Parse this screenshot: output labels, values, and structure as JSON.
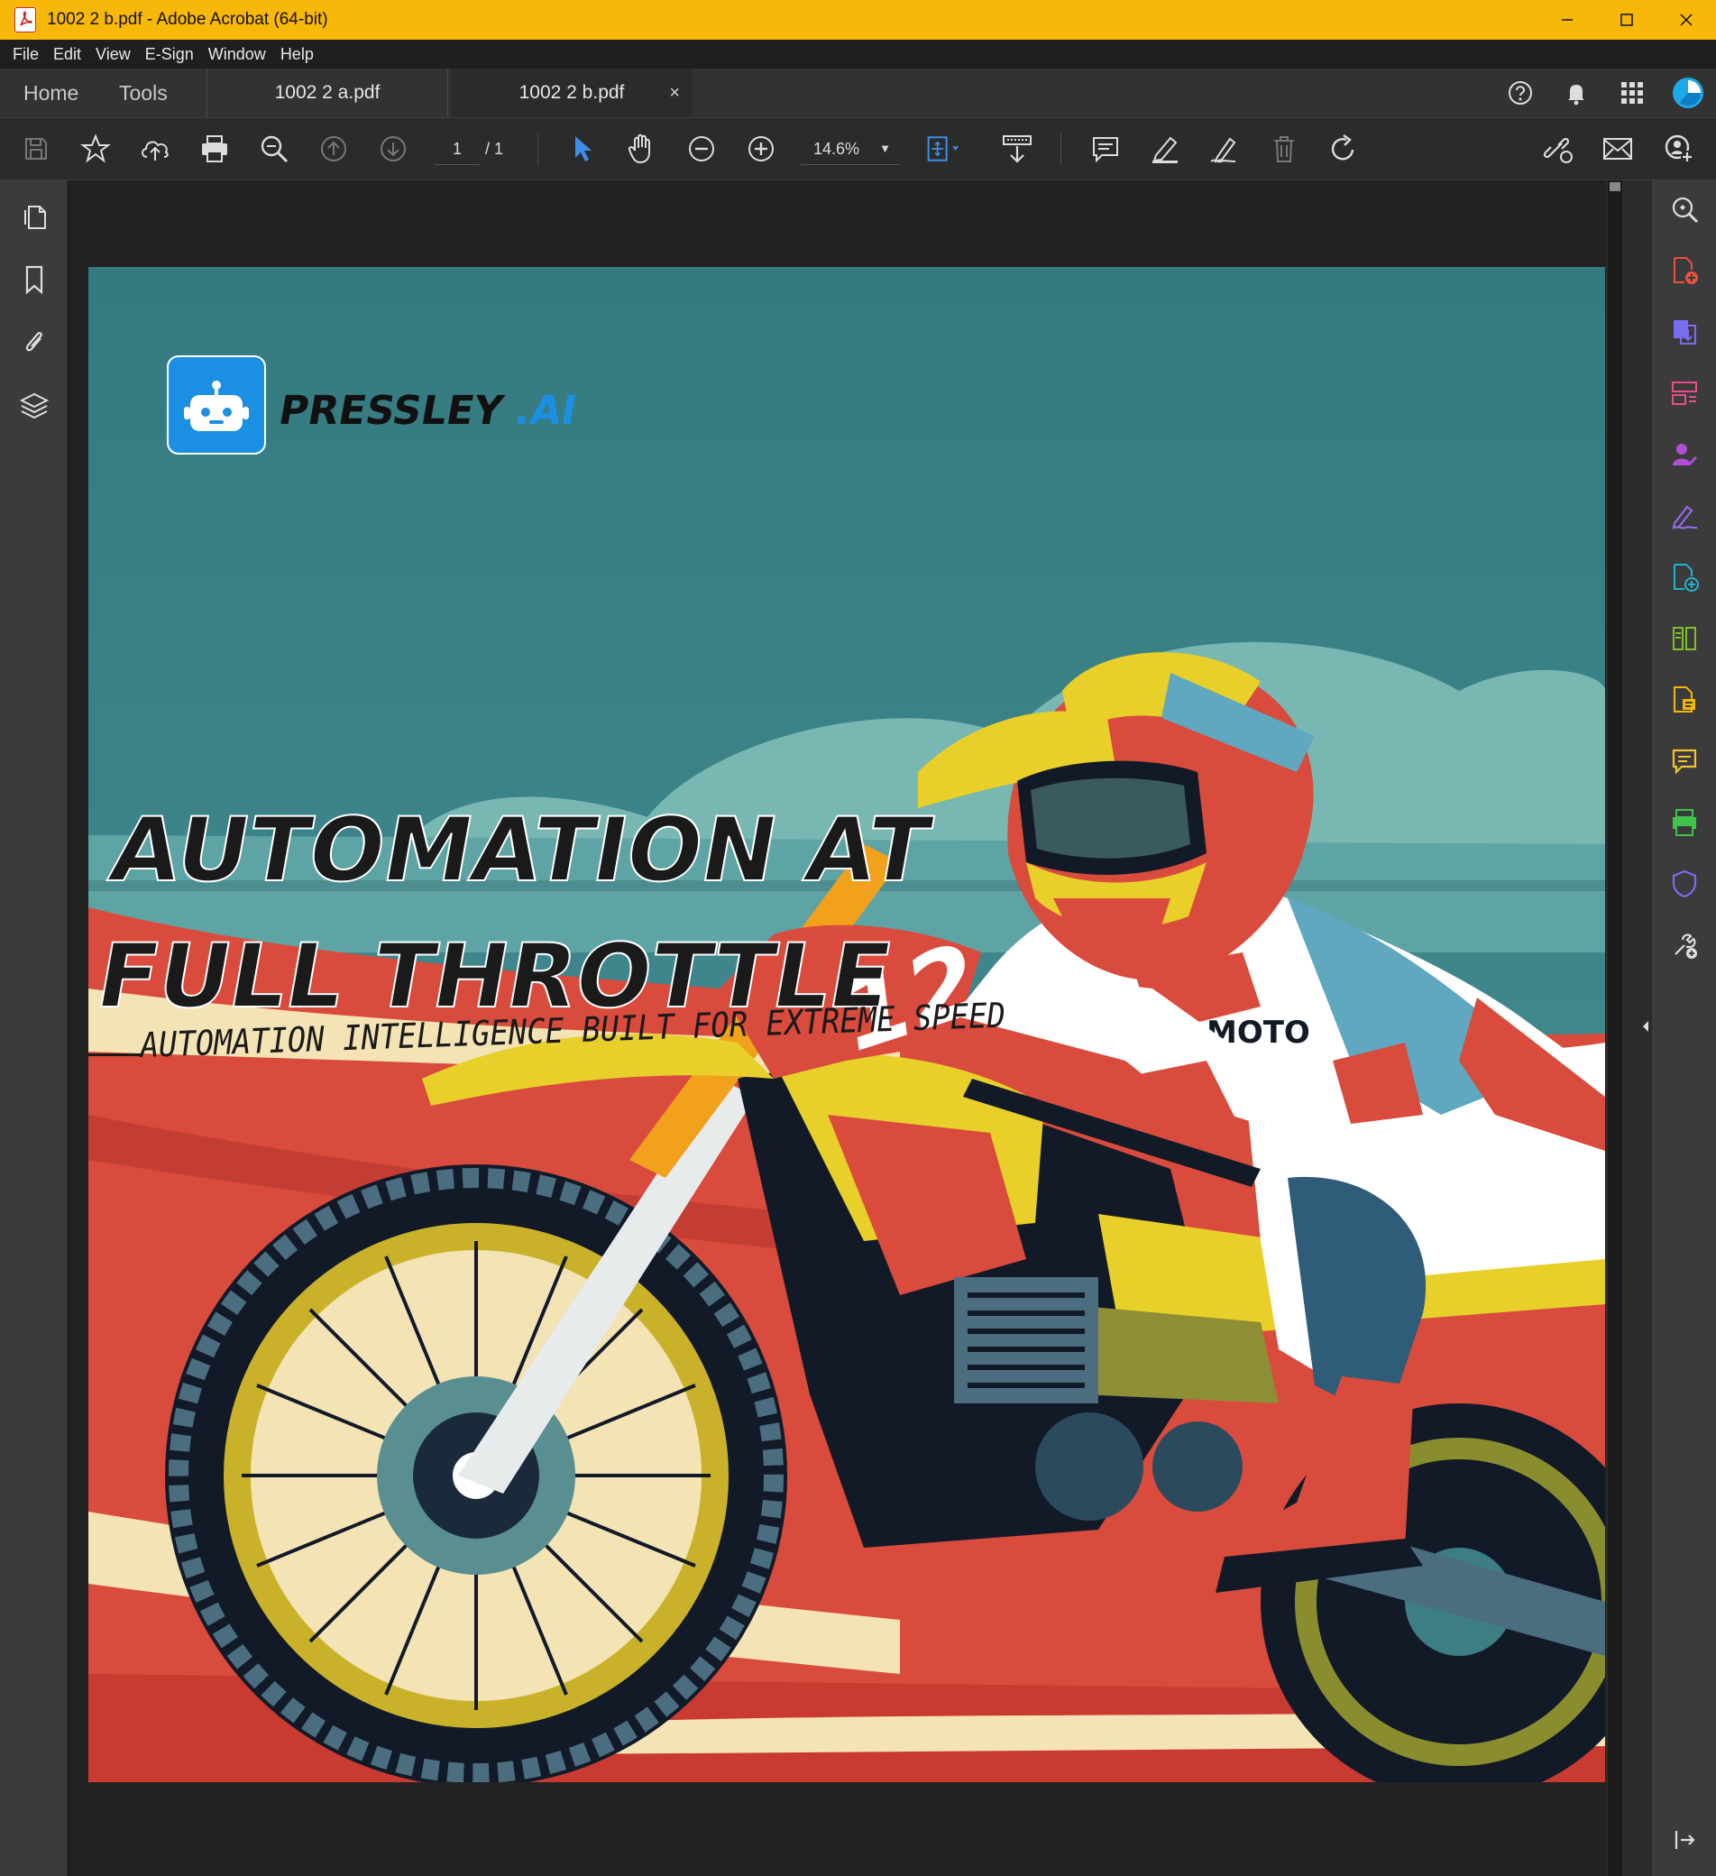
{
  "window": {
    "title": "1002 2 b.pdf - Adobe Acrobat (64-bit)",
    "accent_color": "#f8b80a"
  },
  "menu": [
    "File",
    "Edit",
    "View",
    "E-Sign",
    "Window",
    "Help"
  ],
  "tabs": {
    "home": "Home",
    "tools": "Tools",
    "documents": [
      {
        "label": "1002 2 a.pdf",
        "active": false
      },
      {
        "label": "1002 2 b.pdf",
        "active": true
      }
    ],
    "close_glyph": "×"
  },
  "toolbar": {
    "page_current": "1",
    "page_total": "/ 1",
    "zoom": "14.6%"
  },
  "icons": {
    "tab_right": [
      "help-icon",
      "bell-icon",
      "apps-grid-icon",
      "account-avatar-icon"
    ],
    "toolbar": [
      "save-icon",
      "star-icon",
      "cloud-upload-icon",
      "print-icon",
      "zoom-search-icon",
      "page-up-icon",
      "page-down-icon",
      "select-cursor-icon",
      "hand-icon",
      "zoom-out-icon",
      "zoom-in-icon",
      "fit-page-icon",
      "scroll-mode-icon",
      "comment-icon",
      "highlight-icon",
      "draw-icon",
      "delete-icon",
      "rotate-icon",
      "share-link-icon",
      "email-icon",
      "share-user-icon"
    ],
    "left_rail": [
      "page-thumbnails-icon",
      "bookmark-icon",
      "attachment-icon",
      "layers-icon"
    ],
    "right_rail": [
      "search-zoom-icon",
      "create-pdf-icon",
      "export-pdf-icon",
      "organize-pages-icon",
      "request-signature-icon",
      "fill-sign-icon",
      "combine-files-icon",
      "compress-pdf-icon",
      "edit-pdf-icon",
      "comment-tool-icon",
      "scan-ocr-icon",
      "protect-icon",
      "more-tools-icon",
      "expand-panel-icon"
    ]
  },
  "document": {
    "brand": "PRESSLEY",
    "brand_suffix": ".AI",
    "headline_line1": "AUTOMATION AT",
    "headline_line2": "FULL THROTTLE",
    "tagline": "AUTOMATION INTELLIGENCE BUILT FOR EXTREME SPEED",
    "bike_number": "12",
    "jersey_text": "MOTO"
  }
}
